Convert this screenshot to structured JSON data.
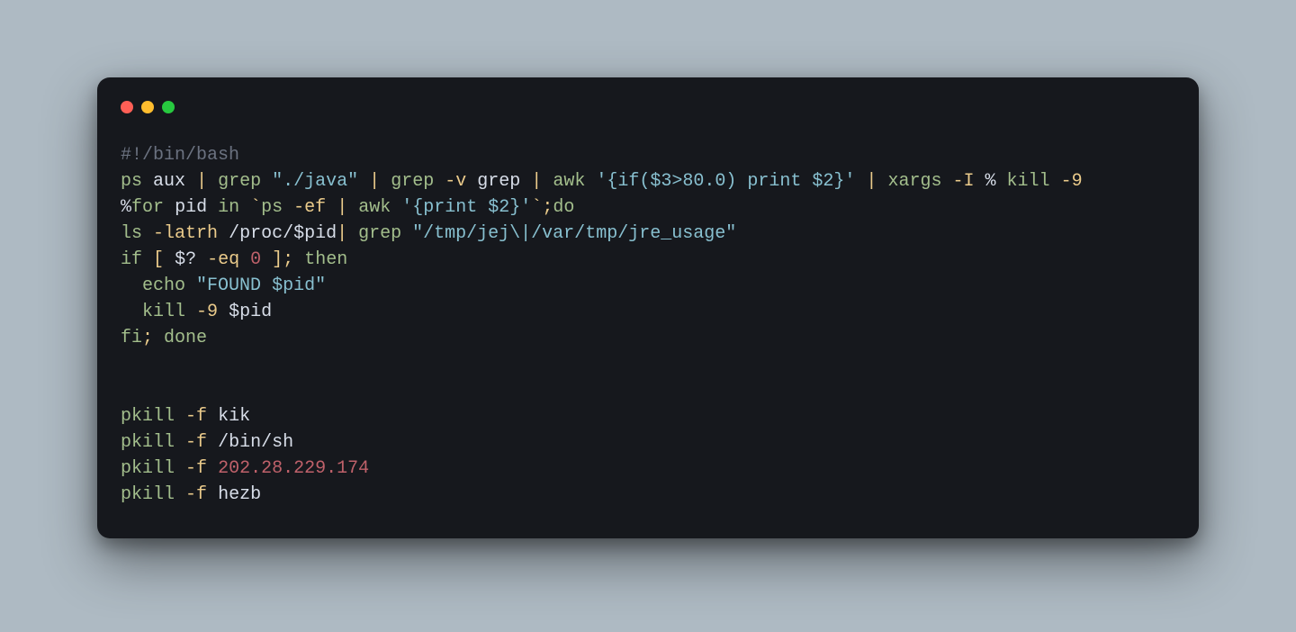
{
  "traffic_lights": {
    "red": "#ff5f56",
    "yellow": "#ffbd2e",
    "green": "#27c93f"
  },
  "code": {
    "l1": {
      "shebang": "#!/bin/bash"
    },
    "l2": {
      "ps": "ps",
      "aux": "aux",
      "pipe1": "|",
      "grep1": "grep",
      "str1": "\"./java\"",
      "pipe2": "|",
      "grep2": "grep",
      "flag_v": "-v",
      "grep_word": "grep",
      "pipe3": "|",
      "awk": "awk",
      "awk_prog": "'{if($3>80.0) print $2}'",
      "pipe4": "|",
      "xargs": "xargs",
      "flag_I": "-I",
      "pct": "%",
      "kill": "kill",
      "neg9": "-9",
      "tail_pct": "%"
    },
    "l3": {
      "lead_pct": "%",
      "for": "or",
      "pid": "pid",
      "in": "in",
      "bt1": "`",
      "ps": "ps",
      "ef": "-ef",
      "pipe": "|",
      "awk": "awk",
      "awk_prog": "'{print $2}'",
      "bt2": "`",
      "semi": ";",
      "do": "do"
    },
    "l4": {
      "ls": "ls",
      "latrh": "-latrh",
      "path": "/proc/$pid",
      "pipe": "|",
      "grep": "grep",
      "str": "\"/tmp/jej\\|/var/tmp/jre_usage\""
    },
    "l5": {
      "if": "if",
      "lb": "[",
      "var": "$?",
      "eq": "-eq",
      "zero": "0",
      "rb": "]",
      "semi": ";",
      "then": "then"
    },
    "l6": {
      "echo": "echo",
      "str_a": "\"FOUND ",
      "str_b": "$pid",
      "str_c": "\""
    },
    "l7": {
      "kill": "kill",
      "neg9": "-9",
      "var": "$pid"
    },
    "l8": {
      "fi": "fi",
      "semi": ";",
      "done": "done"
    },
    "l9": {
      "blank": ""
    },
    "l10": {
      "blank": ""
    },
    "l11": {
      "pkill": "pkill",
      "f": "-f",
      "arg": "kik"
    },
    "l12": {
      "pkill": "pkill",
      "f": "-f",
      "arg": "/bin/sh"
    },
    "l13": {
      "pkill": "pkill",
      "f": "-f",
      "arg": "202.28.229.174"
    },
    "l14": {
      "pkill": "pkill",
      "f": "-f",
      "arg": "hezb"
    }
  }
}
